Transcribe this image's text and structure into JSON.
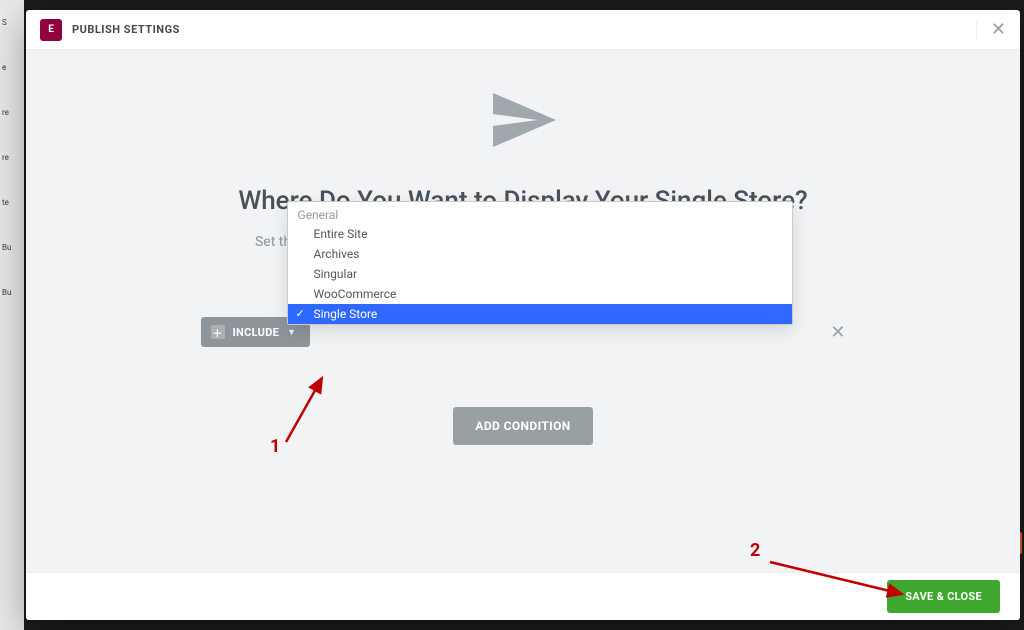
{
  "header": {
    "title": "PUBLISH SETTINGS",
    "logo_text": "E"
  },
  "page": {
    "heading": "Where Do You Want to Display Your Single Store?",
    "subheading": "Set the conditions that determine where your Single Store is used throughout your site."
  },
  "condition": {
    "include_label": "INCLUDE",
    "dropdown_group": "General",
    "options": [
      "Entire Site",
      "Archives",
      "Singular",
      "WooCommerce",
      "Single Store"
    ],
    "selected": "Single Store"
  },
  "buttons": {
    "add_condition": "ADD CONDITION",
    "save_close": "SAVE & CLOSE"
  },
  "annotations": {
    "num1": "1",
    "num2": "2"
  }
}
